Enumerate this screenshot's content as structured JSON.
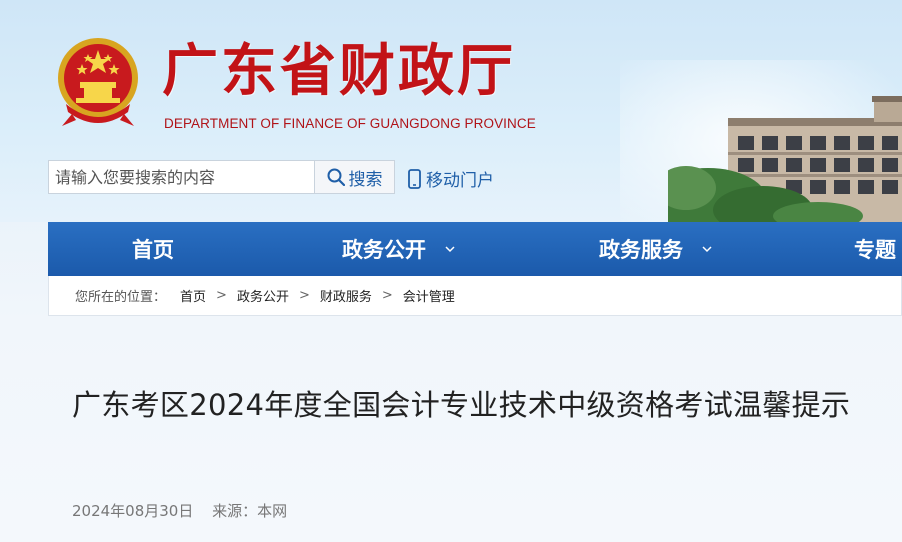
{
  "header": {
    "title": "广东省财政厅",
    "subtitle": "DEPARTMENT OF FINANCE OF GUANGDONG PROVINCE",
    "emblem_icon": "national-emblem-icon",
    "brand_color": "#c21317"
  },
  "search": {
    "placeholder": "请输入您要搜索的内容",
    "value": "",
    "button_label": "搜索",
    "button_icon": "search-icon"
  },
  "mobile_portal": {
    "label": "移动门户",
    "icon": "mobile-phone-icon"
  },
  "nav": {
    "color": "#1b5aab",
    "items": [
      {
        "label": "首页",
        "has_dropdown": false
      },
      {
        "label": "政务公开",
        "has_dropdown": true
      },
      {
        "label": "政务服务",
        "has_dropdown": true
      },
      {
        "label": "专题",
        "has_dropdown": false
      }
    ]
  },
  "breadcrumb": {
    "prefix": "您所在的位置：",
    "items": [
      "首页",
      "政务公开",
      "财政服务",
      "会计管理"
    ],
    "separator": ">"
  },
  "article": {
    "title": "广东考区2024年度全国会计专业技术中级资格考试温馨提示",
    "date": "2024年08月30日",
    "source": "来源：本网"
  }
}
